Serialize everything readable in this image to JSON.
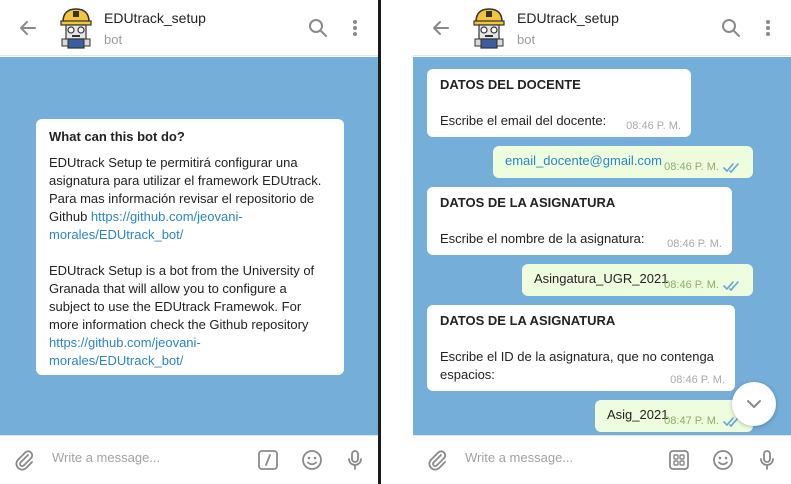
{
  "left": {
    "header": {
      "name": "EDUtrack_setup",
      "subtitle": "bot"
    },
    "info": {
      "title": "What can this bot do?",
      "es_lines": [
        "EDUtrack Setup te permitirá configurar una",
        "asignatura para utilizar el framework EDUtrack.",
        "Para mas información revisar el repositorio de"
      ],
      "es_last_prefix": "Github ",
      "es_link_line1": "https://github.com/jeovani-",
      "es_link_line2": "morales/EDUtrack_bot/",
      "en_lines": [
        "EDUtrack Setup is a bot from the University of",
        "Granada that will allow you to configure a",
        "subject to use the EDUtrack Framewok. For",
        "more information check the Github repository"
      ],
      "en_link_line1": "https://github.com/jeovani-",
      "en_link_line2": "morales/EDUtrack_bot/"
    },
    "composer": {
      "placeholder": "Write a message..."
    }
  },
  "right": {
    "header": {
      "name": "EDUtrack_setup",
      "subtitle": "bot"
    },
    "messages": [
      {
        "title": "DATOS DEL DOCENTE",
        "body": "Escribe el email del docente:",
        "time": "08:46 P. M."
      },
      {
        "text": "email_docente@gmail.com",
        "time": "08:46 P. M."
      },
      {
        "title": "DATOS DE LA ASIGNATURA",
        "body": "Escribe el nombre de la asignatura:",
        "time": "08:46 P. M."
      },
      {
        "text": "Asingatura_UGR_2021",
        "time": "08:46 P. M."
      },
      {
        "title": "DATOS DE LA ASIGNATURA",
        "body_line1": "Escribe el ID de la asignatura, que no contenga",
        "body_line2": "espacios:",
        "time": "08:46 P. M."
      },
      {
        "text": "Asig_2021",
        "time": "08:47 P. M."
      }
    ],
    "composer": {
      "placeholder": "Write a message..."
    }
  },
  "icons": {
    "back": "arrow-left-icon",
    "search": "search-icon",
    "more": "more-vertical-icon",
    "attach": "paperclip-icon",
    "commands": "slash-command-icon",
    "keyboard": "bot-keyboard-icon",
    "emoji": "smile-icon",
    "mic": "microphone-icon",
    "scroll": "chevron-down-icon",
    "read": "double-check-icon"
  },
  "colors": {
    "chat_bg": "#74aed9",
    "link": "#2a85c9",
    "out_bubble": "#eefdde",
    "tick": "#5ea7d8"
  }
}
